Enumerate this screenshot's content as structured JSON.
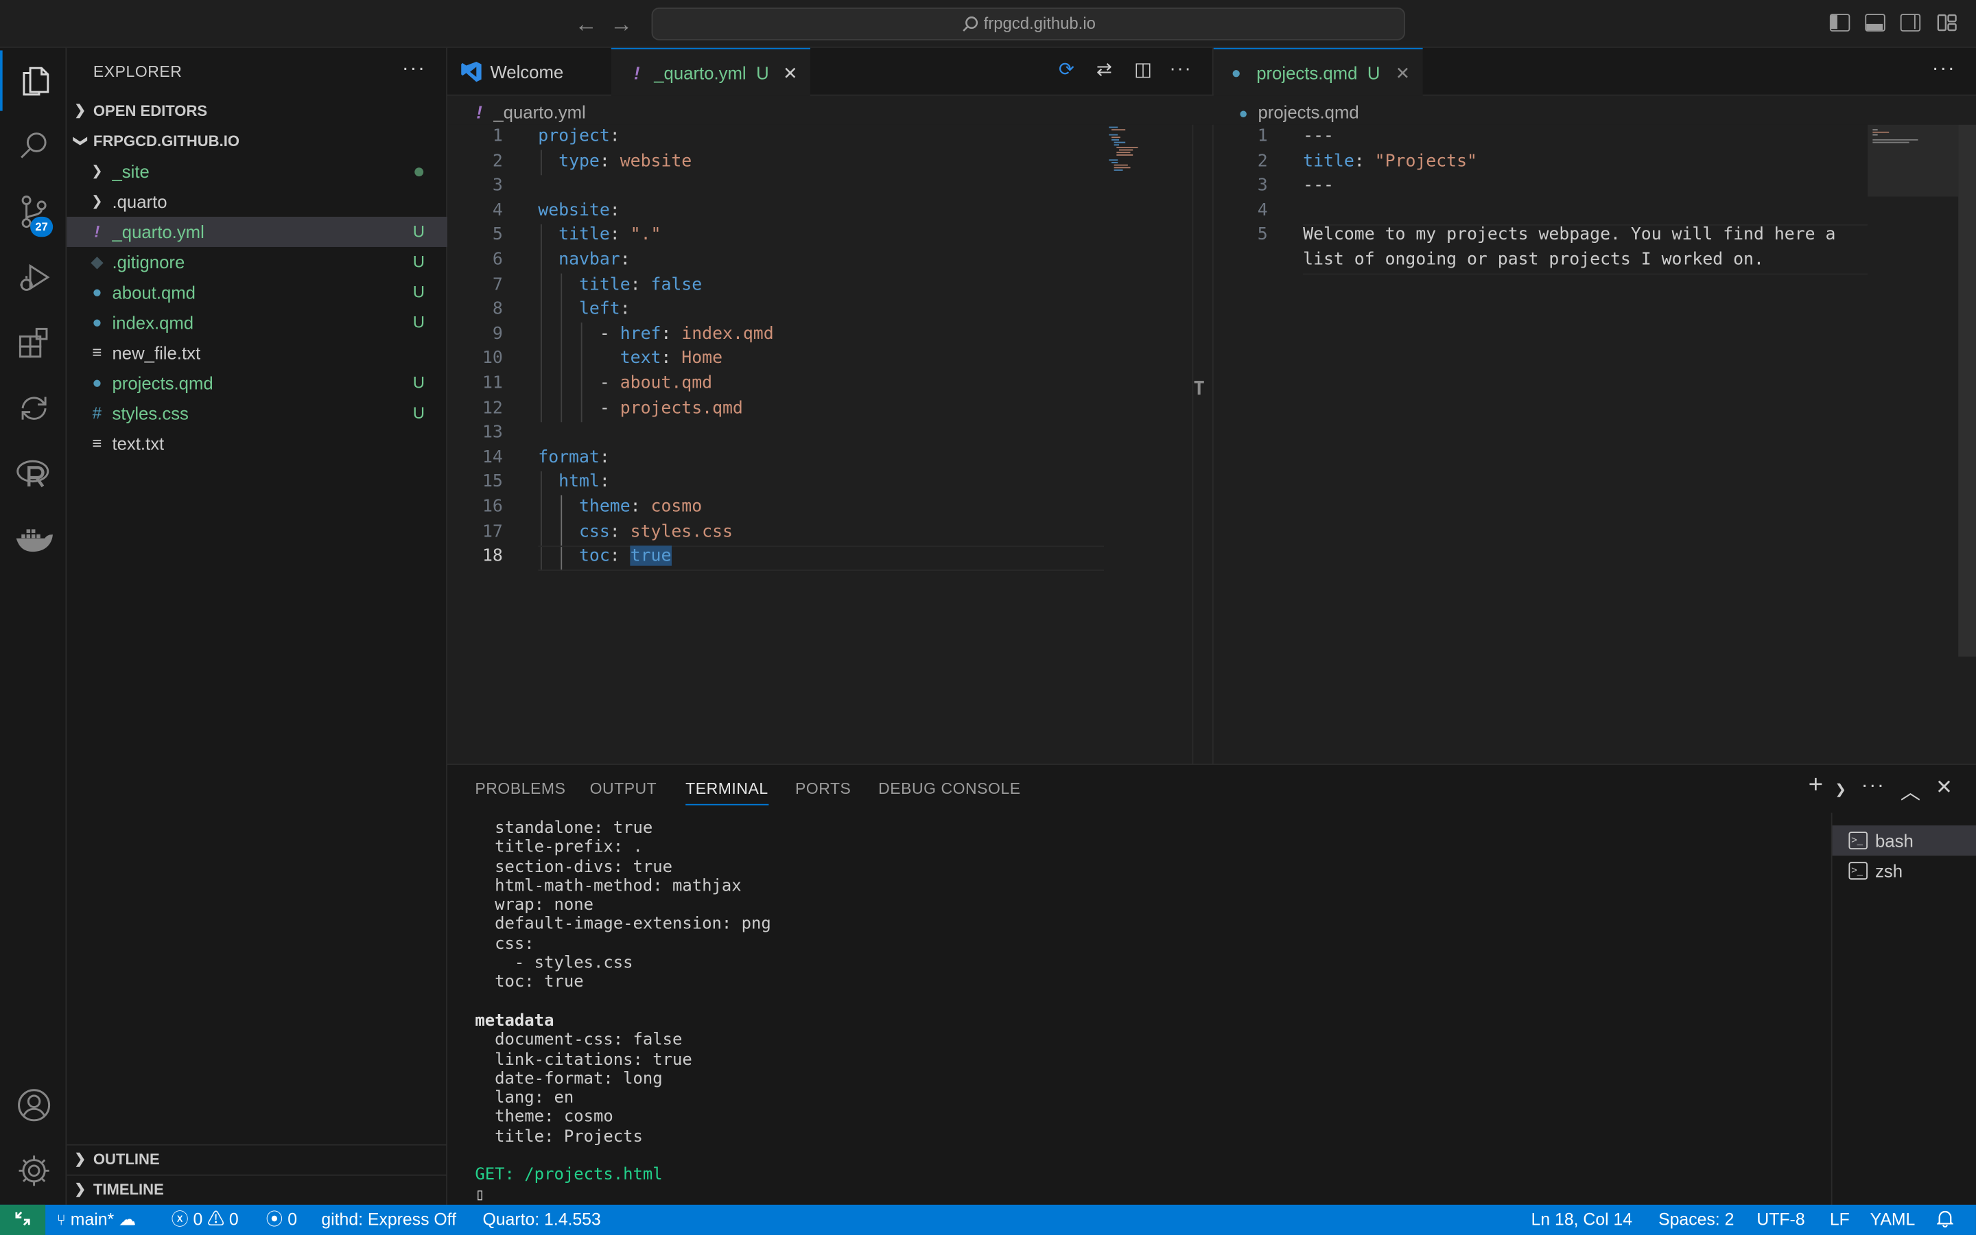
{
  "titlebar": {
    "search_text": "frpgcd.github.io"
  },
  "activity_bar": {
    "source_control_badge": "27"
  },
  "sidebar": {
    "title": "EXPLORER",
    "open_editors": "OPEN EDITORS",
    "folder": "FRPGCD.GITHUB.IO",
    "items": [
      {
        "name": "_site",
        "status": ""
      },
      {
        "name": ".quarto",
        "status": ""
      },
      {
        "name": "_quarto.yml",
        "status": "U"
      },
      {
        "name": ".gitignore",
        "status": "U"
      },
      {
        "name": "about.qmd",
        "status": "U"
      },
      {
        "name": "index.qmd",
        "status": "U"
      },
      {
        "name": "new_file.txt",
        "status": ""
      },
      {
        "name": "projects.qmd",
        "status": "U"
      },
      {
        "name": "styles.css",
        "status": "U"
      },
      {
        "name": "text.txt",
        "status": ""
      }
    ],
    "outline": "OUTLINE",
    "timeline": "TIMELINE"
  },
  "editor_left": {
    "tabs": [
      {
        "label": "Welcome"
      },
      {
        "label": "_quarto.yml",
        "status": "U"
      }
    ],
    "breadcrumb": "_quarto.yml",
    "line_numbers": [
      "1",
      "2",
      "3",
      "4",
      "5",
      "6",
      "7",
      "8",
      "9",
      "10",
      "11",
      "12",
      "13",
      "14",
      "15",
      "16",
      "17",
      "18"
    ]
  },
  "editor_right": {
    "tabs": [
      {
        "label": "projects.qmd",
        "status": "U"
      }
    ],
    "breadcrumb": "projects.qmd",
    "line_numbers": [
      "1",
      "2",
      "3",
      "4",
      "5"
    ]
  },
  "panel": {
    "tabs": [
      "PROBLEMS",
      "OUTPUT",
      "TERMINAL",
      "PORTS",
      "DEBUG CONSOLE"
    ],
    "terminal_lines": [
      "  standalone: true",
      "  title-prefix: .",
      "  section-divs: true",
      "  html-math-method: mathjax",
      "  wrap: none",
      "  default-image-extension: png",
      "  css:",
      "    - styles.css",
      "  toc: true",
      "",
      "metadata",
      "  document-css: false",
      "  link-citations: true",
      "  date-format: long",
      "  lang: en",
      "  theme: cosmo",
      "  title: Projects",
      "",
      "GET: /projects.html",
      "▯"
    ],
    "terminals": [
      "bash",
      "zsh"
    ]
  },
  "statusbar": {
    "branch": "main*",
    "errors": "0",
    "warnings": "0",
    "ports": "0",
    "githd": "githd: Express Off",
    "quarto": "Quarto: 1.4.553",
    "position": "Ln 18, Col 14",
    "spaces": "Spaces: 2",
    "encoding": "UTF-8",
    "eol": "LF",
    "language": "YAML"
  },
  "colors": {
    "accent": "#0078d4",
    "untracked": "#73c991",
    "keyword": "#569cd6",
    "string": "#ce9178"
  }
}
